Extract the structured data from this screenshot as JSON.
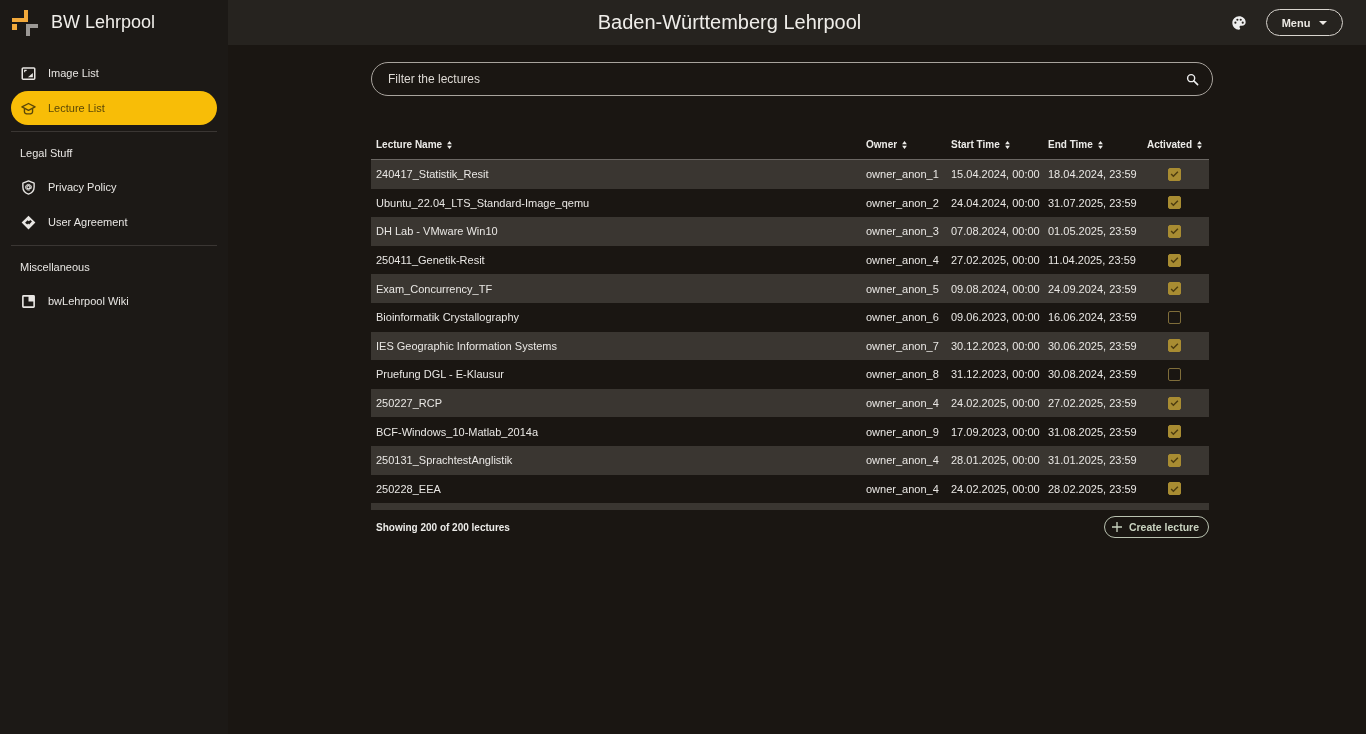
{
  "sidebar": {
    "title": "BW Lehrpool",
    "items": [
      {
        "label": "Image List",
        "selected": false
      },
      {
        "label": "Lecture List",
        "selected": true
      }
    ],
    "sections": [
      {
        "heading": "Legal Stuff",
        "items": [
          {
            "label": "Privacy Policy",
            "selected": false
          },
          {
            "label": "User Agreement",
            "selected": false
          }
        ]
      },
      {
        "heading": "Miscellaneous",
        "items": [
          {
            "label": "bwLehrpool Wiki",
            "selected": false
          }
        ]
      }
    ]
  },
  "header": {
    "title": "Baden-Württemberg Lehrpool",
    "menu_button": "Menu"
  },
  "search": {
    "placeholder": "Filter the lectures"
  },
  "table": {
    "columns": [
      {
        "label": "Lecture Name"
      },
      {
        "label": "Owner"
      },
      {
        "label": "Start Time"
      },
      {
        "label": "End Time"
      },
      {
        "label": "Activated"
      }
    ],
    "rows": [
      {
        "name": "240417_Statistik_Resit",
        "owner": "owner_anon_1",
        "start_time": "15.04.2024, 00:00",
        "end_time": "18.04.2024, 23:59",
        "activated": true
      },
      {
        "name": "Ubuntu_22.04_LTS_Standard-Image_qemu",
        "owner": "owner_anon_2",
        "start_time": "24.04.2024, 00:00",
        "end_time": "31.07.2025, 23:59",
        "activated": true
      },
      {
        "name": "DH Lab - VMware Win10",
        "owner": "owner_anon_3",
        "start_time": "07.08.2024, 00:00",
        "end_time": "01.05.2025, 23:59",
        "activated": true
      },
      {
        "name": "250411_Genetik-Resit",
        "owner": "owner_anon_4",
        "start_time": "27.02.2025, 00:00",
        "end_time": "11.04.2025, 23:59",
        "activated": true
      },
      {
        "name": "Exam_Concurrency_TF",
        "owner": "owner_anon_5",
        "start_time": "09.08.2024, 00:00",
        "end_time": "24.09.2024, 23:59",
        "activated": true
      },
      {
        "name": "Bioinformatik Crystallography",
        "owner": "owner_anon_6",
        "start_time": "09.06.2023, 00:00",
        "end_time": "16.06.2024, 23:59",
        "activated": false
      },
      {
        "name": "IES Geographic Information Systems",
        "owner": "owner_anon_7",
        "start_time": "30.12.2023, 00:00",
        "end_time": "30.06.2025, 23:59",
        "activated": true
      },
      {
        "name": "Pruefung DGL - E-Klausur",
        "owner": "owner_anon_8",
        "start_time": "31.12.2023, 00:00",
        "end_time": "30.08.2024, 23:59",
        "activated": false
      },
      {
        "name": "250227_RCP",
        "owner": "owner_anon_4",
        "start_time": "24.02.2025, 00:00",
        "end_time": "27.02.2025, 23:59",
        "activated": true
      },
      {
        "name": "BCF-Windows_10-Matlab_2014a",
        "owner": "owner_anon_9",
        "start_time": "17.09.2023, 00:00",
        "end_time": "31.08.2025, 23:59",
        "activated": true
      },
      {
        "name": "250131_SprachtestAnglistik",
        "owner": "owner_anon_4",
        "start_time": "28.01.2025, 00:00",
        "end_time": "31.01.2025, 23:59",
        "activated": true
      },
      {
        "name": "250228_EEA",
        "owner": "owner_anon_4",
        "start_time": "24.02.2025, 00:00",
        "end_time": "28.02.2025, 23:59",
        "activated": true
      }
    ]
  },
  "footer": {
    "summary": "Showing 200 of 200 lectures",
    "create_button": "Create lecture"
  }
}
